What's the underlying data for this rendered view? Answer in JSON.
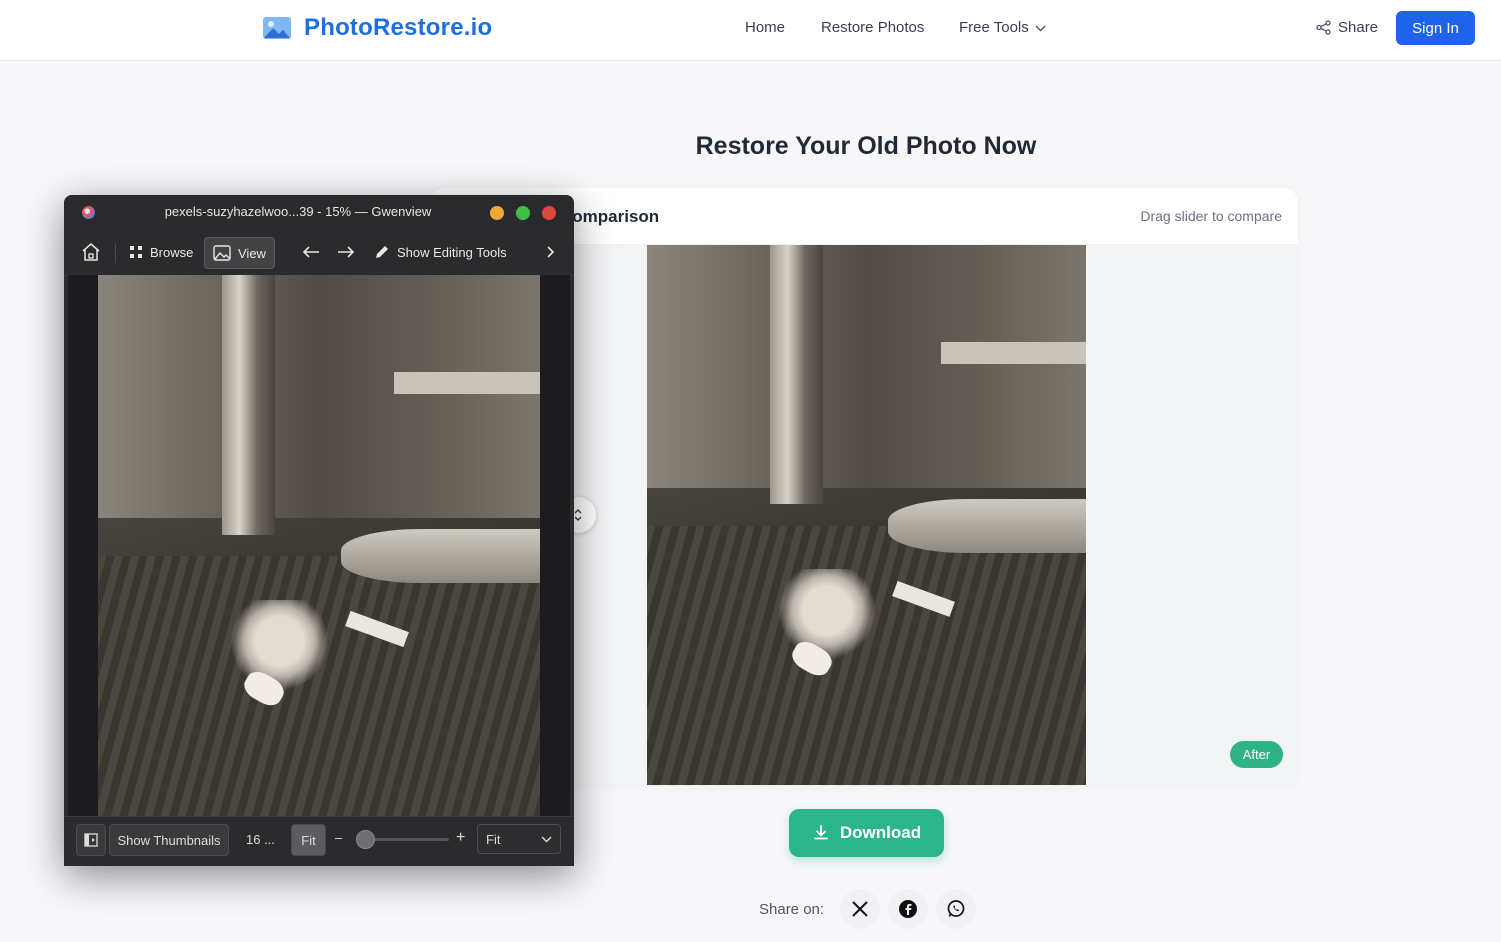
{
  "site": {
    "logo_text": "PhotoRestore.io",
    "nav": {
      "home": "Home",
      "restore": "Restore Photos",
      "tools": "Free Tools"
    },
    "share": "Share",
    "signin": "Sign In",
    "colors": {
      "brand": "#1f6fe0",
      "primary_button": "#1e63e9",
      "accent_green": "#2cb58a"
    }
  },
  "main": {
    "title": "Restore Your Old Photo Now",
    "comparison": {
      "title": "Comparison",
      "hint": "Drag slider to compare",
      "after_label": "After"
    },
    "download": "Download",
    "share_on": "Share on:",
    "share_icons": [
      "x-icon",
      "facebook-icon",
      "whatsapp-icon"
    ]
  },
  "gwenview": {
    "title": "pexels-suzyhazelwoo...39 - 15% — Gwenview",
    "toolbar": {
      "browse": "Browse",
      "view": "View",
      "edit": "Show Editing Tools"
    },
    "status": {
      "thumbnails": "Show Thumbnails",
      "count": "16 ...",
      "fit": "Fit",
      "zoom_minus": "–",
      "zoom_plus": "+",
      "zoom_select": "Fit",
      "zoom_level": 0
    },
    "colors": {
      "close": "#e0443e",
      "minimize": "#f0a731",
      "maximize": "#3fbf4a"
    }
  }
}
